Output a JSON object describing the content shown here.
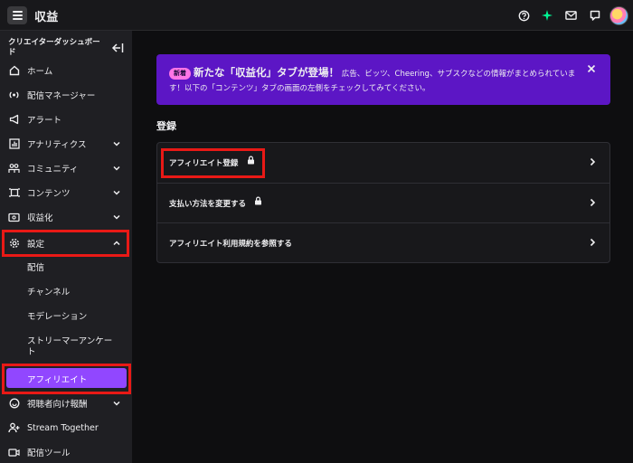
{
  "header": {
    "title": "収益"
  },
  "sidebar": {
    "title": "クリエイターダッシュボード",
    "items": [
      {
        "label": "ホーム"
      },
      {
        "label": "配信マネージャー"
      },
      {
        "label": "アラート"
      },
      {
        "label": "アナリティクス"
      },
      {
        "label": "コミュニティ"
      },
      {
        "label": "コンテンツ"
      },
      {
        "label": "収益化"
      },
      {
        "label": "設定"
      },
      {
        "label": "視聴者向け報酬"
      },
      {
        "label": "Stream Together"
      },
      {
        "label": "配信ツール"
      }
    ],
    "settings_sub": [
      {
        "label": "配信"
      },
      {
        "label": "チャンネル"
      },
      {
        "label": "モデレーション"
      },
      {
        "label": "ストリーマーアンケート"
      },
      {
        "label": "アフィリエイト"
      }
    ]
  },
  "banner": {
    "badge": "新着",
    "headline": "新たな「収益化」タブが登場！",
    "body": "広告、ビッツ、Cheering、サブスクなどの情報がまとめられています！以下の「コンテンツ」タブの画面の左側をチェックしてみてください。"
  },
  "main": {
    "section_title": "登録",
    "rows": [
      {
        "label": "アフィリエイト登録"
      },
      {
        "label": "支払い方法を変更する"
      },
      {
        "label": "アフィリエイト利用規約を参照する"
      }
    ]
  },
  "colors": {
    "accent": "#9147ff",
    "banner": "#5c16c5",
    "highlight": "#e91916",
    "badge": "#ff75e6"
  },
  "icons": [
    "menu-icon",
    "help-icon",
    "sparkle-icon",
    "mail-icon",
    "chat-icon",
    "avatar"
  ]
}
